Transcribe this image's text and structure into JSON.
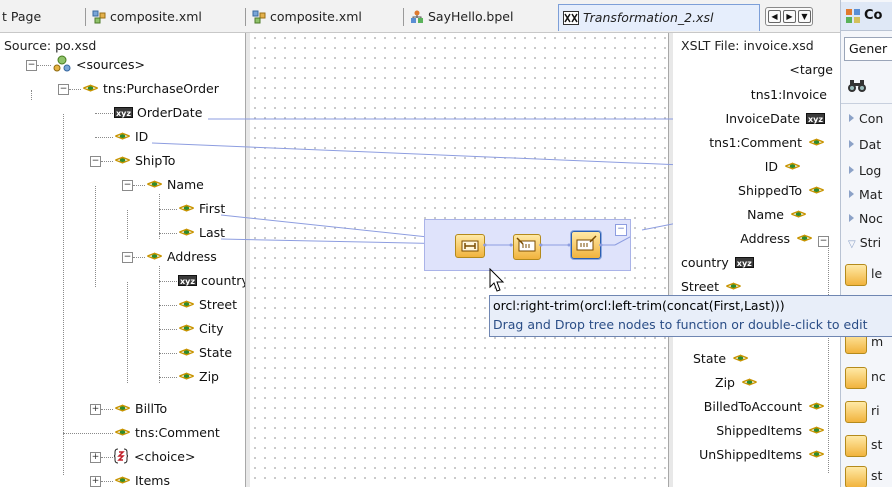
{
  "tabs": [
    {
      "label": "t Page"
    },
    {
      "label": "composite.xml"
    },
    {
      "label": "composite.xml"
    },
    {
      "label": "SayHello.bpel"
    },
    {
      "label": "Transformation_2.xsl"
    }
  ],
  "right_panel": {
    "title": "Co",
    "dropdown": "Gener",
    "categories": [
      "Con",
      "Dat",
      "Log",
      "Mat",
      "Noc",
      "Stri"
    ],
    "functions": [
      "le",
      "m",
      "nc",
      "ri",
      "st",
      "st"
    ]
  },
  "source": {
    "header": "Source: po.xsd",
    "nodes": {
      "sources": "<sources>",
      "purchase_order": "tns:PurchaseOrder",
      "order_date": "OrderDate",
      "id": "ID",
      "ship_to": "ShipTo",
      "name": "Name",
      "first": "First",
      "last": "Last",
      "address": "Address",
      "country": "country",
      "street": "Street",
      "city": "City",
      "state": "State",
      "zip": "Zip",
      "bill_to": "BillTo",
      "comment": "tns:Comment",
      "choice": "<choice>",
      "items": "Items"
    }
  },
  "target": {
    "header": "XSLT File: invoice.xsd",
    "nodes": {
      "target": "<targe",
      "invoice": "tns1:Invoice",
      "invoice_date": "InvoiceDate",
      "comment": "tns1:Comment",
      "id": "ID",
      "shipped_to": "ShippedTo",
      "name": "Name",
      "address": "Address",
      "country": "country",
      "street": "Street",
      "state": "State",
      "zip": "Zip",
      "billed_to_account": "BilledToAccount",
      "shipped_items": "ShippedItems",
      "unshipped_items": "UnShippedItems"
    }
  },
  "tooltip": {
    "line1": "orcl:right-trim(orcl:left-trim(concat(First,Last)))",
    "line2": "Drag and Drop tree nodes to function or double-click to edit"
  },
  "icons": {
    "xml_element": "element-tag-icon",
    "attribute": "xyz-attribute-icon",
    "concat": "concat-function-icon",
    "left_trim": "left-trim-function-icon",
    "right_trim": "right-trim-function-icon"
  },
  "colors": {
    "mapping_line": "#8d9de0",
    "function_group_bg": "#dfe3fb",
    "tooltip_bg": "#e8eef9",
    "active_tab": "#e6eefc"
  }
}
